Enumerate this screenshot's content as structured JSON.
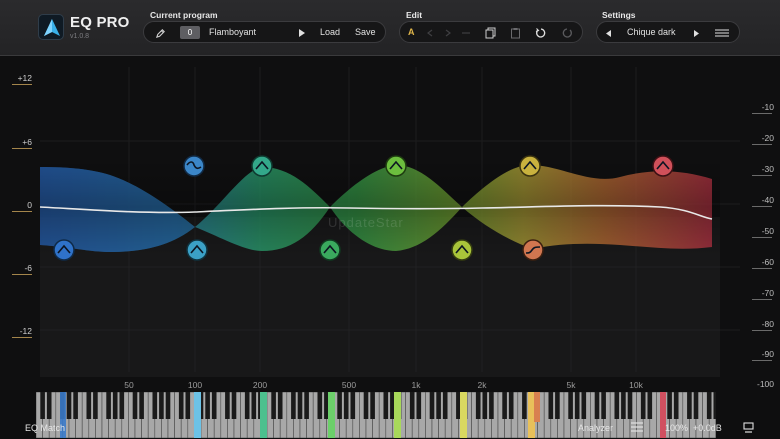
{
  "app": {
    "name": "EQ PRO",
    "version": "v1.0.8"
  },
  "program": {
    "label": "Current program",
    "number": "0",
    "name": "Flamboyant",
    "load": "Load",
    "save": "Save"
  },
  "edit": {
    "label": "Edit",
    "ab": "A"
  },
  "settings": {
    "label": "Settings",
    "theme": "Chique dark"
  },
  "db_left": [
    "+12",
    "+6",
    "0",
    "-6",
    "-12"
  ],
  "db_right": [
    "-10",
    "-20",
    "-30",
    "-40",
    "-50",
    "-60",
    "-70",
    "-80",
    "-90",
    "-100"
  ],
  "freq_labels": [
    "50",
    "100",
    "200",
    "500",
    "1k",
    "2k",
    "5k",
    "10k"
  ],
  "footer": {
    "eq_match": "EQ Match",
    "analyzer": "Analyzer",
    "zoom": "100%",
    "gain": "+0.0dB"
  },
  "watermark": "UpdateStar",
  "band_colors": [
    "#2e6fb5",
    "#3a9dc4",
    "#2fa38a",
    "#3fae5a",
    "#7cbf3c",
    "#b6c23a",
    "#c79a3a",
    "#c75a3a",
    "#b83a4a"
  ]
}
